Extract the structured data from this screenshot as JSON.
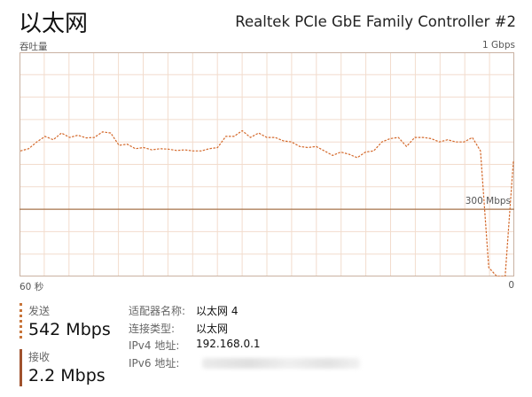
{
  "header": {
    "title": "以太网",
    "adapter_model": "Realtek PCIe GbE Family Controller #2"
  },
  "graph": {
    "throughput_label": "吞吐量",
    "max_label": "1 Gbps",
    "time_label": "60 秒",
    "zero_label": "0",
    "reference_line_label": "300 Mbps",
    "grid_color": "#f2dccd",
    "line_color": "#d4692b",
    "ref_color": "#a7754d"
  },
  "chart_data": {
    "type": "line",
    "y_unit": "Mbps",
    "ylim": [
      0,
      1000
    ],
    "x_label": "60 秒",
    "x_range_seconds": [
      60,
      0
    ],
    "reference_line": 300,
    "series": [
      {
        "values": [
          560,
          570,
          600,
          625,
          610,
          640,
          620,
          630,
          618,
          620,
          645,
          640,
          585,
          590,
          570,
          575,
          565,
          570,
          568,
          562,
          565,
          560,
          560,
          570,
          575,
          625,
          625,
          650,
          620,
          640,
          620,
          620,
          605,
          600,
          580,
          575,
          580,
          560,
          540,
          555,
          545,
          530,
          555,
          560,
          600,
          615,
          620,
          580,
          620,
          620,
          615,
          600,
          610,
          600,
          600,
          620,
          560,
          40,
          0,
          0,
          515
        ]
      }
    ]
  },
  "stats": {
    "send": {
      "label": "发送",
      "value": "542 Mbps"
    },
    "receive": {
      "label": "接收",
      "value": "2.2 Mbps"
    }
  },
  "details": [
    {
      "key": "适配器名称:",
      "value": "以太网 4"
    },
    {
      "key": "连接类型:",
      "value": "以太网"
    },
    {
      "key": "IPv4 地址:",
      "value": "192.168.0.1"
    },
    {
      "key": "IPv6 地址:",
      "value": ""
    }
  ]
}
